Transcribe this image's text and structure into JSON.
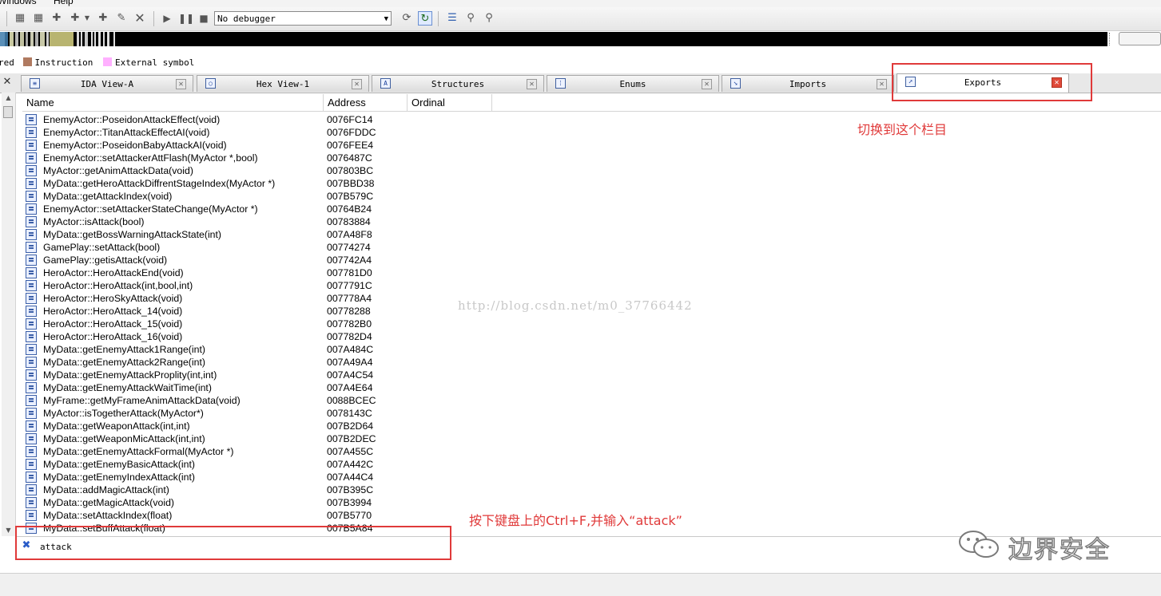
{
  "menu": {
    "items": [
      "Windows",
      "Help"
    ]
  },
  "toolbar": {
    "debugger_select": "No debugger",
    "icons": [
      "new-icon",
      "new-segment-icon",
      "add-icon",
      "add-2-icon",
      "dropdown-icon",
      "add-3-icon",
      "edit-icon",
      "delete-icon",
      "play-icon",
      "pause-icon",
      "stop-icon",
      "trace-icon",
      "cycle-icon",
      "list-icon",
      "hook-icon",
      "unhook-icon"
    ]
  },
  "legend": {
    "partial_label": "red",
    "items": [
      {
        "label": "Instruction",
        "color": "#b07a60"
      },
      {
        "label": "External symbol",
        "color": "#ffb0ff"
      }
    ]
  },
  "tabs": [
    {
      "label": "IDA View-A",
      "icon": "ida-view-icon",
      "active": false
    },
    {
      "label": "Hex View-1",
      "icon": "hex-view-icon",
      "active": false
    },
    {
      "label": "Structures",
      "icon": "structures-icon",
      "active": false
    },
    {
      "label": "Enums",
      "icon": "enums-icon",
      "active": false
    },
    {
      "label": "Imports",
      "icon": "imports-icon",
      "active": false
    },
    {
      "label": "Exports",
      "icon": "exports-icon",
      "active": true
    }
  ],
  "table": {
    "columns": [
      "Name",
      "Address",
      "Ordinal"
    ],
    "rows": [
      {
        "name": "EnemyActor::PoseidonAttackEffect(void)",
        "address": "0076FC14"
      },
      {
        "name": "EnemyActor::TitanAttackEffectAI(void)",
        "address": "0076FDDC"
      },
      {
        "name": "EnemyActor::PoseidonBabyAttackAI(void)",
        "address": "0076FEE4"
      },
      {
        "name": "EnemyActor::setAttackerAttFlash(MyActor *,bool)",
        "address": "0076487C"
      },
      {
        "name": "MyActor::getAnimAttackData(void)",
        "address": "007803BC"
      },
      {
        "name": "MyData::getHeroAttackDiffrentStageIndex(MyActor *)",
        "address": "007BBD38"
      },
      {
        "name": "MyData::getAttackIndex(void)",
        "address": "007B579C"
      },
      {
        "name": "EnemyActor::setAttackerStateChange(MyActor *)",
        "address": "00764B24"
      },
      {
        "name": "MyActor::isAttack(bool)",
        "address": "00783884"
      },
      {
        "name": "MyData::getBossWarningAttackState(int)",
        "address": "007A48F8"
      },
      {
        "name": "GamePlay::setAttack(bool)",
        "address": "00774274"
      },
      {
        "name": "GamePlay::getisAttack(void)",
        "address": "007742A4"
      },
      {
        "name": "HeroActor::HeroAttackEnd(void)",
        "address": "007781D0"
      },
      {
        "name": "HeroActor::HeroAttack(int,bool,int)",
        "address": "0077791C"
      },
      {
        "name": "HeroActor::HeroSkyAttack(void)",
        "address": "007778A4"
      },
      {
        "name": "HeroActor::HeroAttack_14(void)",
        "address": "00778288"
      },
      {
        "name": "HeroActor::HeroAttack_15(void)",
        "address": "007782B0"
      },
      {
        "name": "HeroActor::HeroAttack_16(void)",
        "address": "007782D4"
      },
      {
        "name": "MyData::getEnemyAttack1Range(int)",
        "address": "007A484C"
      },
      {
        "name": "MyData::getEnemyAttack2Range(int)",
        "address": "007A49A4"
      },
      {
        "name": "MyData::getEnemyAttackProplity(int,int)",
        "address": "007A4C54"
      },
      {
        "name": "MyData::getEnemyAttackWaitTime(int)",
        "address": "007A4E64"
      },
      {
        "name": "MyFrame::getMyFrameAnimAttackData(void)",
        "address": "0088BCEC"
      },
      {
        "name": "MyActor::isTogetherAttack(MyActor*)",
        "address": "0078143C"
      },
      {
        "name": "MyData::getWeaponAttack(int,int)",
        "address": "007B2D64"
      },
      {
        "name": "MyData::getWeaponMicAttack(int,int)",
        "address": "007B2DEC"
      },
      {
        "name": "MyData::getEnemyAttackFormal(MyActor *)",
        "address": "007A455C"
      },
      {
        "name": "MyData::getEnemyBasicAttack(int)",
        "address": "007A442C"
      },
      {
        "name": "MyData::getEnemyIndexAttack(int)",
        "address": "007A44C4"
      },
      {
        "name": "MyData::addMagicAttack(int)",
        "address": "007B395C"
      },
      {
        "name": "MyData::getMagicAttack(void)",
        "address": "007B3994"
      },
      {
        "name": "MyData::setAttackIndex(float)",
        "address": "007B5770"
      },
      {
        "name": "MyData::setBuffAttack(float)",
        "address": "007B5A84"
      }
    ]
  },
  "search": {
    "value": "attack"
  },
  "annotations": {
    "switch_tab_note": "切换到这个栏目",
    "search_note": "按下键盘上的Ctrl+F,并输入“attack”",
    "color": "#e03a3a"
  },
  "watermark": "http://blog.csdn.net/m0_37766442",
  "brand": {
    "name": "边界安全"
  }
}
